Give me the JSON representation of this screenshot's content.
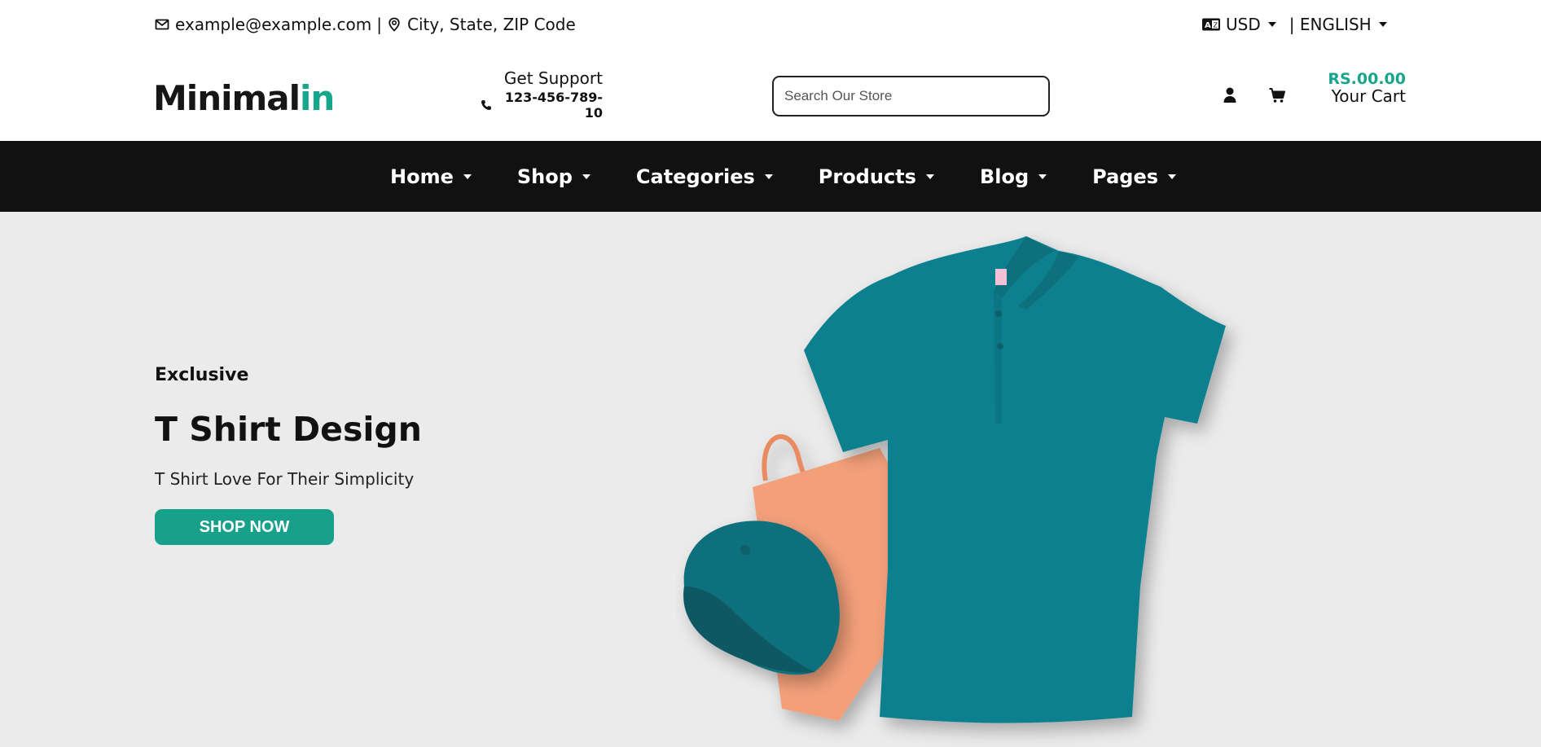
{
  "topbar": {
    "email": "example@example.com",
    "separator": "|",
    "address": "City, State, ZIP Code",
    "currency": "USD",
    "language": "| ENGLISH"
  },
  "header": {
    "logo_main": "Minimal",
    "logo_accent": "in",
    "support_title": "Get Support",
    "support_phone": "123-456-789-10",
    "search_placeholder": "Search Our Store",
    "cart_amount": "RS.00.00",
    "cart_label": "Your Cart"
  },
  "nav": {
    "items": [
      {
        "label": "Home"
      },
      {
        "label": "Shop"
      },
      {
        "label": "Categories"
      },
      {
        "label": "Products"
      },
      {
        "label": "Blog"
      },
      {
        "label": "Pages"
      }
    ]
  },
  "hero": {
    "kicker": "Exclusive",
    "title": "T Shirt Design",
    "subtitle": "T Shirt Love For Their Simplicity",
    "cta": "SHOP NOW"
  },
  "colors": {
    "accent": "#17a58c",
    "nav_bg": "#111111",
    "hero_bg": "#ebebeb",
    "shirt": "#11808f",
    "bag": "#f3a07a"
  },
  "icons": [
    "mail-icon",
    "location-pin-icon",
    "language-icon",
    "phone-icon",
    "user-icon",
    "cart-icon",
    "chevron-down-icon"
  ]
}
